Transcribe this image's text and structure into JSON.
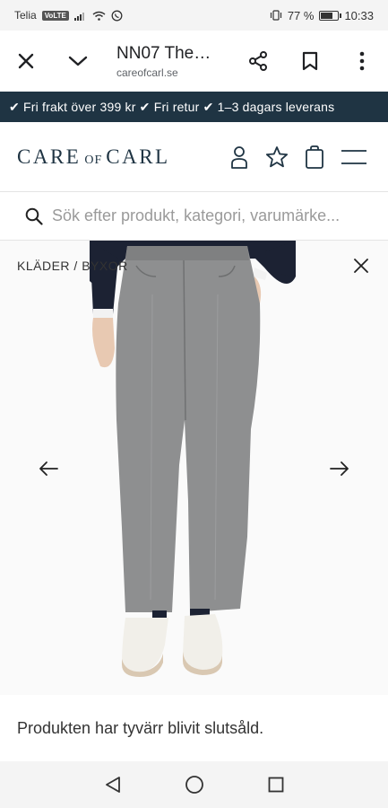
{
  "status_bar": {
    "carrier": "Telia",
    "volte": "VoLTE",
    "battery_text": "77 %",
    "battery_level": 0.77,
    "time": "10:33"
  },
  "browser": {
    "page_title": "NN07 The…",
    "url": "careofcarl.se",
    "icons": [
      "close-icon",
      "chevron-down-icon",
      "share-icon",
      "bookmark-icon",
      "more-vert-icon"
    ]
  },
  "promo": {
    "text": "✔ Fri frakt över 399 kr ✔ Fri retur ✔ 1–3 dagars leverans"
  },
  "site_header": {
    "logo_left": "CARE",
    "logo_mid": "OF",
    "logo_right": "CARL",
    "icons": [
      "account-icon",
      "star-icon",
      "bag-icon",
      "menu-icon"
    ],
    "brand_color": "#1f3443"
  },
  "search": {
    "placeholder": "Sök efter produkt, kategori, varumärke..."
  },
  "product": {
    "breadcrumb": "KLÄDER / BYXOR",
    "image_icons": [
      "close-icon",
      "arrow-left-icon",
      "arrow-right-icon"
    ]
  },
  "sold_out": {
    "text": "Produkten har tyvärr blivit slutsåld."
  },
  "nav": {
    "icons": [
      "back-icon",
      "home-icon",
      "recents-icon"
    ]
  }
}
